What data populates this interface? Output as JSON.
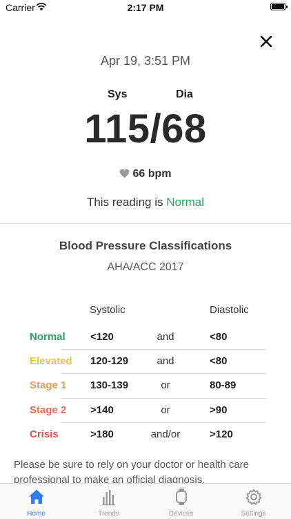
{
  "status_bar": {
    "carrier": "Carrier",
    "time": "2:17 PM"
  },
  "reading": {
    "date": "Apr 19, 3:51 PM",
    "sys_label": "Sys",
    "dia_label": "Dia",
    "value": "115/68",
    "pulse": "66 bpm",
    "status_prefix": "This reading is",
    "status_value": "Normal",
    "status_color": "#2aa463"
  },
  "classifications": {
    "title": "Blood Pressure Classifications",
    "subtitle": "AHA/ACC 2017",
    "col_systolic": "Systolic",
    "col_diastolic": "Diastolic",
    "rows": [
      {
        "name": "Normal",
        "systolic": "<120",
        "conj": "and",
        "diastolic": "<80",
        "color": "#2aa463"
      },
      {
        "name": "Elevated",
        "systolic": "120-129",
        "conj": "and",
        "diastolic": "<80",
        "color": "#e8c53a"
      },
      {
        "name": "Stage 1",
        "systolic": "130-139",
        "conj": "or",
        "diastolic": "80-89",
        "color": "#e89a4a"
      },
      {
        "name": "Stage 2",
        "systolic": ">140",
        "conj": "or",
        "diastolic": ">90",
        "color": "#e06a5a"
      },
      {
        "name": "Crisis",
        "systolic": ">180",
        "conj": "and/or",
        "diastolic": ">120",
        "color": "#d9534f"
      }
    ]
  },
  "disclaimer": "Please be sure to rely on your doctor or health care professional to make an official diagnosis.",
  "tab_bar": {
    "tabs": [
      {
        "label": "Home",
        "icon": "home-icon"
      },
      {
        "label": "Trends",
        "icon": "bar-chart-icon"
      },
      {
        "label": "Devices",
        "icon": "watch-icon"
      },
      {
        "label": "Settings",
        "icon": "gear-icon"
      }
    ],
    "active_color": "#2f7cf6"
  }
}
